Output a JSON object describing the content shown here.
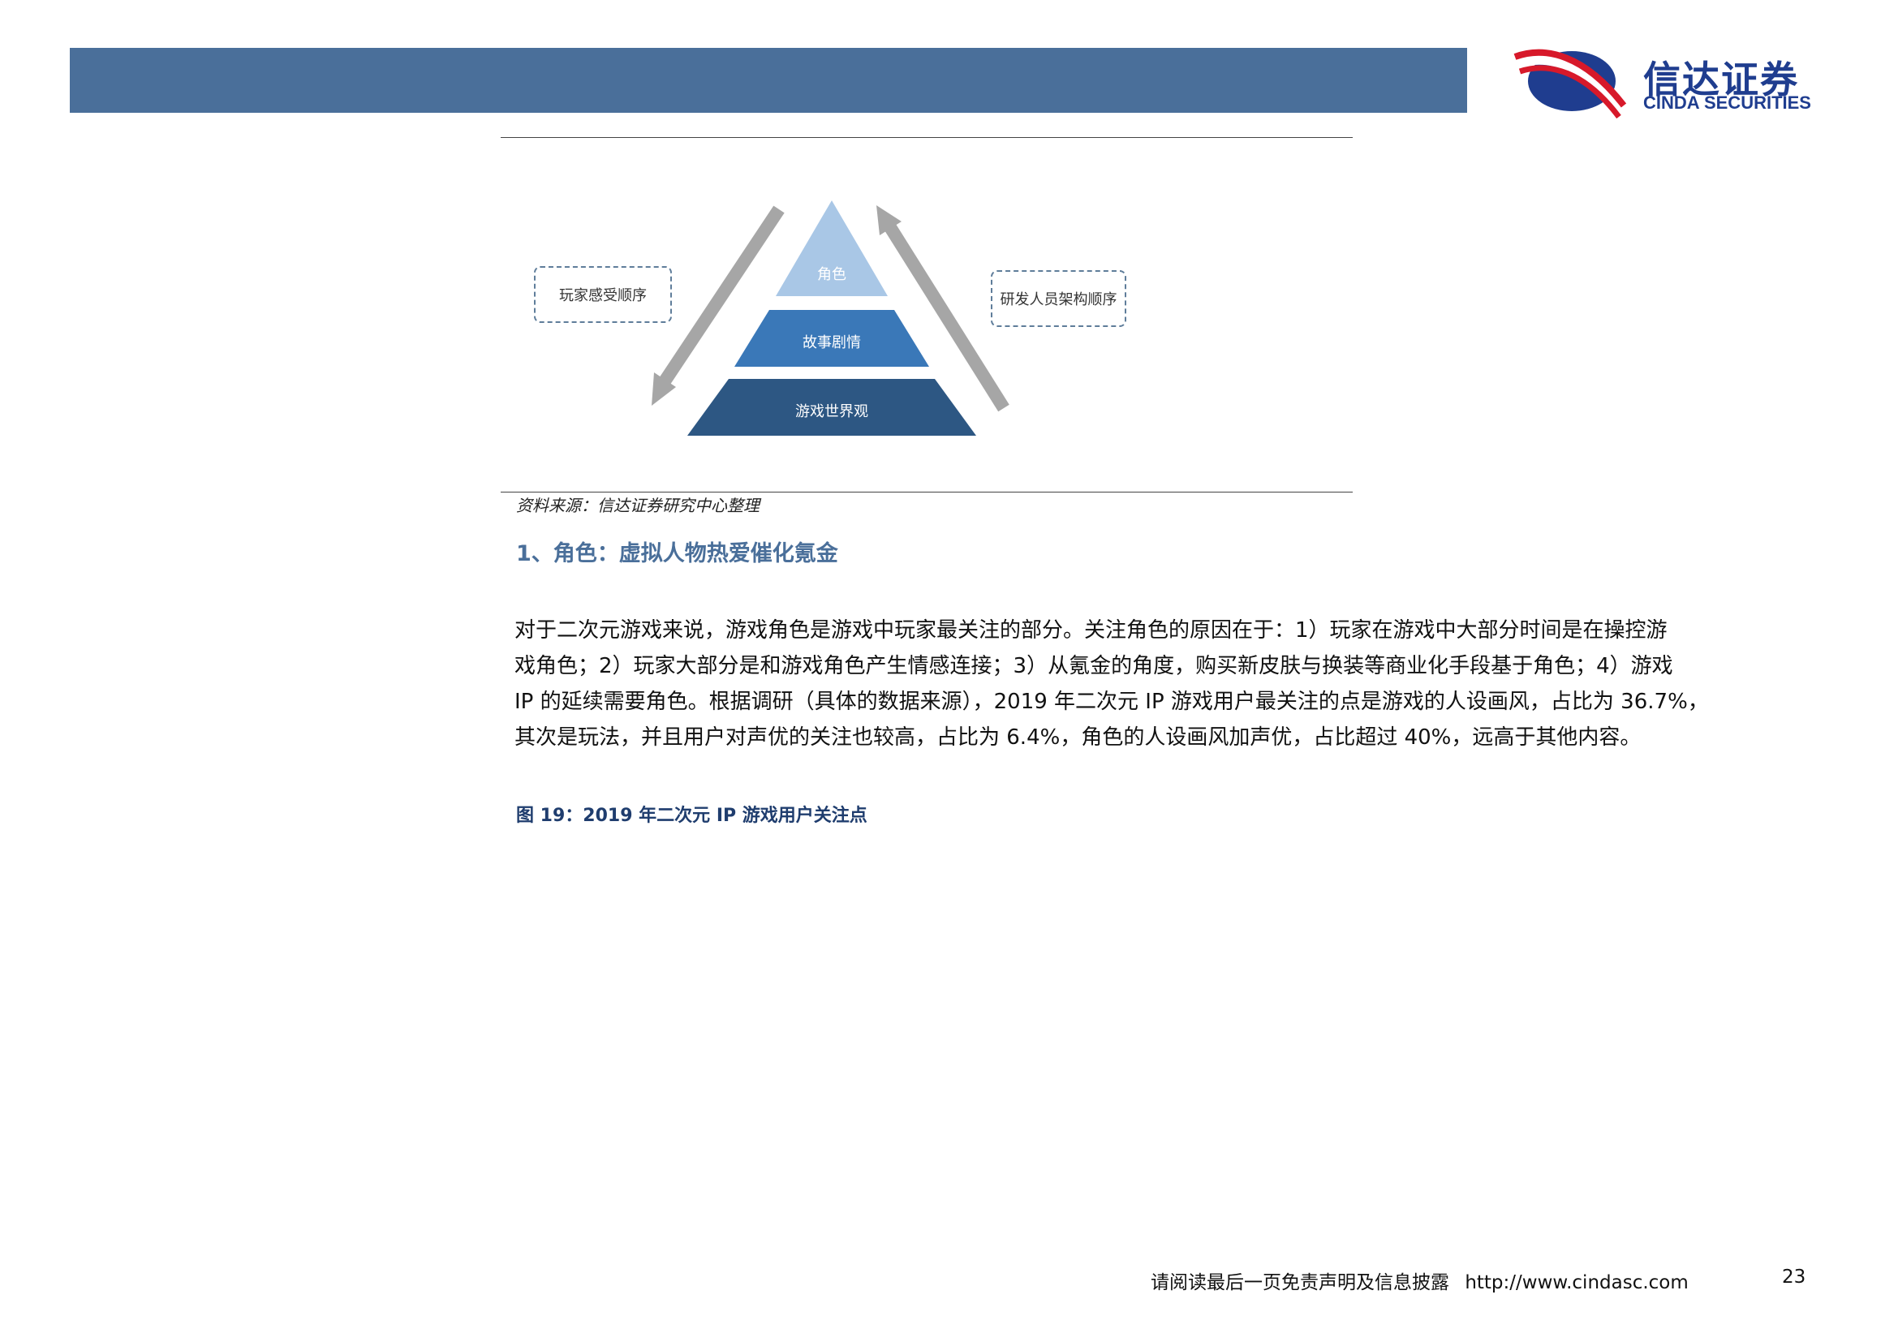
{
  "header": {
    "logo_cn": "信达证券",
    "logo_en": "CINDA SECURITIES"
  },
  "diagram": {
    "tiers": [
      {
        "label": "角色",
        "color": "#a9c7e6"
      },
      {
        "label": "故事剧情",
        "color": "#3a78b8"
      },
      {
        "label": "游戏世界观",
        "color": "#2d5783"
      }
    ],
    "left_note": "玩家感受顺序",
    "right_note": "研发人员架构顺序",
    "arrow_color": "#a6a6a6"
  },
  "source": "资料来源：信达证券研究中心整理",
  "section": {
    "heading": "1、角色：虚拟人物热爱催化氪金",
    "paragraph_lines": [
      "对于二次元游戏来说，游戏角色是游戏中玩家最关注的部分。关注角色的原因在于：1）玩家在游戏中大部分时间是在操控游",
      "戏角色；2）玩家大部分是和游戏角色产生情感连接；3）从氪金的角度，购买新皮肤与换装等商业化手段基于角色；4）游戏",
      "IP 的延续需要角色。根据调研（具体的数据来源），2019 年二次元 IP 游戏用户最关注的点是游戏的人设画风，占比为 36.7%，",
      "其次是玩法，并且用户对声优的关注也较高，占比为 6.4%，角色的人设画风加声优，占比超过 40%，远高于其他内容。"
    ]
  },
  "figure_caption": "图 19：2019 年二次元 IP 游戏用户关注点",
  "footer": {
    "disclaimer": "请阅读最后一页免责声明及信息披露",
    "url": "http://www.cindasc.com",
    "page_number": "23"
  },
  "colors": {
    "header_bar": "#4a6f9a",
    "logo_blue": "#1f3d8f",
    "logo_red": "#d7192a",
    "heading": "#4a6f9a"
  }
}
